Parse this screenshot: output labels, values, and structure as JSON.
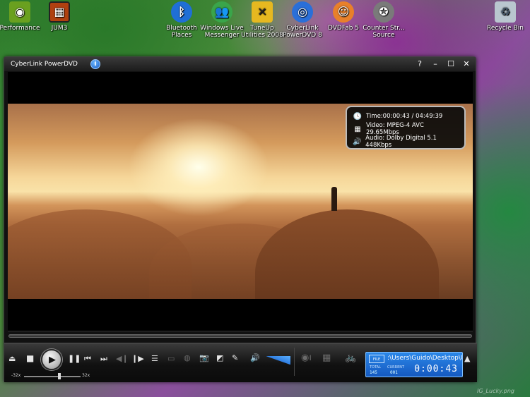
{
  "desktop": {
    "icons": [
      {
        "label": "Performance",
        "icon": "nvidia-icon",
        "color": "#6aa01f"
      },
      {
        "label": "JUM3",
        "icon": "film-strip-icon",
        "color": "#b04010"
      },
      {
        "label": "Bluetooth Places",
        "icon": "bluetooth-icon",
        "color": "#1f6fd6"
      },
      {
        "label": "Windows Live Messenger",
        "icon": "messenger-icon",
        "color": "#3aa54a"
      },
      {
        "label": "TuneUp Utilities 2008",
        "icon": "tuneup-icon",
        "color": "#e6b820"
      },
      {
        "label": "CyberLink PowerDVD 8",
        "icon": "powerdvd-icon",
        "color": "#2a6fd8"
      },
      {
        "label": "DVDFab 5",
        "icon": "dvdfab-icon",
        "color": "#e8802a"
      },
      {
        "label": "Counter Str... Source",
        "icon": "counter-strike-icon",
        "color": "#7a7a7a"
      },
      {
        "label": "Recycle Bin",
        "icon": "recycle-bin-icon",
        "color": "#b9c6cf"
      }
    ],
    "watermark": "IG_Lucky.png"
  },
  "window": {
    "title": "CyberLink PowerDVD",
    "info_button": "i",
    "controls": {
      "help": "?",
      "minimize": "–",
      "maximize": "☐",
      "close": "✕"
    }
  },
  "osd": {
    "time": "Time:00:00:43 / 04:49:39",
    "video": "Video: MPEG-4 AVC  29.65Mbps",
    "audio": "Audio: Dolby Digital 5.1   448Kbps"
  },
  "playback": {
    "speed_min": "-32x",
    "speed_max": "32x",
    "speed_level": 0.62,
    "volume_level": 0.9
  },
  "lcd": {
    "disc_label": "FILE",
    "path": ":\\Users\\Guido\\Desktop\\U",
    "total_label": "TOTAL",
    "total_value": "145",
    "current_label": "CURRENT",
    "current_value": "001",
    "time": "0:00:43"
  }
}
